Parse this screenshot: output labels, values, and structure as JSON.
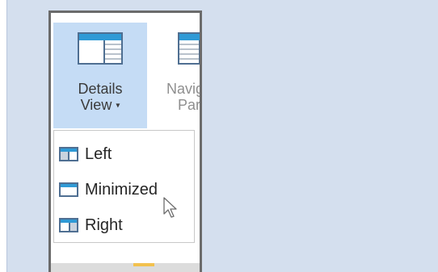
{
  "ribbon": {
    "details_view": {
      "line1": "Details",
      "line2": "View",
      "caret": "▾",
      "icon": "details-view-icon"
    },
    "navigation_pane": {
      "line1": "Navig",
      "line2": "Par",
      "icon": "navigation-pane-icon"
    }
  },
  "menu": {
    "items": [
      {
        "label": "Left",
        "icon": "layout-left-icon"
      },
      {
        "label": "Minimized",
        "icon": "layout-minimized-icon"
      },
      {
        "label": "Right",
        "icon": "layout-right-icon"
      }
    ]
  },
  "colors": {
    "background": "#d4dfee",
    "selected_button": "#c5dcf5",
    "icon_accent": "#2f9ad6"
  }
}
